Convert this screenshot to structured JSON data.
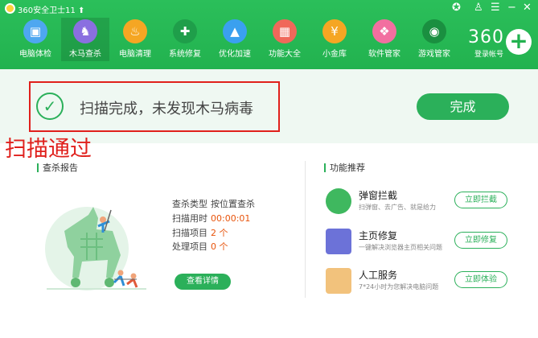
{
  "app": {
    "title": "360安全卫士11 ⬆"
  },
  "nav": [
    {
      "label": "电脑体检",
      "icon": "monitor-icon",
      "color": "#4ea7f0",
      "glyph": "▣"
    },
    {
      "label": "木马查杀",
      "icon": "horse-icon",
      "color": "#8a6fe0",
      "glyph": "♞"
    },
    {
      "label": "电脑清理",
      "icon": "broom-icon",
      "color": "#f5a623",
      "glyph": "♨"
    },
    {
      "label": "系统修复",
      "icon": "shield-icon",
      "color": "#1f9e4a",
      "glyph": "✚"
    },
    {
      "label": "优化加速",
      "icon": "rocket-icon",
      "color": "#3aa0ef",
      "glyph": "▲"
    },
    {
      "label": "功能大全",
      "icon": "grid-icon",
      "color": "#f0685a",
      "glyph": "▦"
    },
    {
      "label": "小金库",
      "icon": "coin-icon",
      "color": "#f5a623",
      "glyph": "¥"
    },
    {
      "label": "软件管家",
      "icon": "apps-icon",
      "color": "#f26fa0",
      "glyph": "❖"
    },
    {
      "label": "游戏管家",
      "icon": "gamepad-icon",
      "color": "#1a8f40",
      "glyph": "◉"
    }
  ],
  "account": {
    "logo": "360",
    "label": "登录帐号"
  },
  "result": {
    "message": "扫描完成，未发现木马病毒",
    "done_label": "完成",
    "pass_label": "扫描通过"
  },
  "report": {
    "title": "查杀报告",
    "rows": [
      {
        "k": "查杀类型",
        "v": "按位置查杀"
      },
      {
        "k": "扫描用时",
        "v": "00:00:01"
      },
      {
        "k": "扫描项目",
        "v": "2 个"
      },
      {
        "k": "处理项目",
        "v": "0 个"
      }
    ],
    "detail_label": "查看详情"
  },
  "features": {
    "title": "功能推荐",
    "items": [
      {
        "name": "弹窗拦截",
        "desc": "扫弹窗、去广告、就是给力",
        "button": "立即拦截",
        "icon": "popup-block-icon",
        "color": "#3fb85f"
      },
      {
        "name": "主页修复",
        "desc": "一键解决浏览器主页相关问题",
        "button": "立即修复",
        "icon": "wrench-icon",
        "color": "#6c72d8"
      },
      {
        "name": "人工服务",
        "desc": "7*24小时为您解决电脑问题",
        "button": "立即体验",
        "icon": "support-avatar-icon",
        "color": "#f2c27c"
      }
    ]
  }
}
